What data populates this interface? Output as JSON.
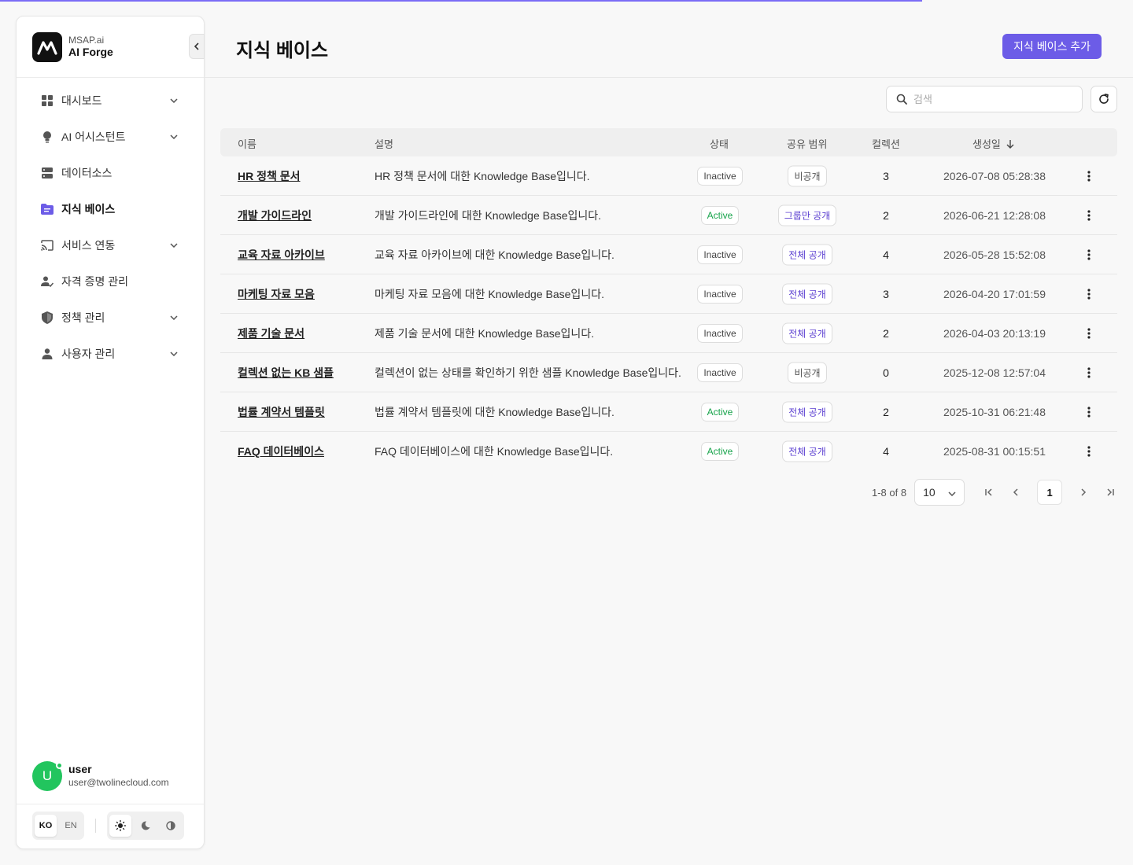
{
  "colors": {
    "accent": "#6c5ce7",
    "active": "#16a34a",
    "scope_text": "#5b3fd1",
    "avatar": "#22c55e"
  },
  "brand": {
    "sub": "MSAP.ai",
    "name": "AI Forge"
  },
  "sidebar": {
    "items": [
      {
        "label": "대시보드",
        "icon": "dashboard-icon",
        "expandable": true
      },
      {
        "label": "AI 어시스턴트",
        "icon": "lightbulb-icon",
        "expandable": true
      },
      {
        "label": "데이터소스",
        "icon": "server-icon",
        "expandable": false
      },
      {
        "label": "지식 베이스",
        "icon": "folder-icon",
        "expandable": false,
        "active": true
      },
      {
        "label": "서비스 연동",
        "icon": "cast-icon",
        "expandable": true
      },
      {
        "label": "자격 증명 관리",
        "icon": "user-check-icon",
        "expandable": false
      },
      {
        "label": "정책 관리",
        "icon": "shield-icon",
        "expandable": true
      },
      {
        "label": "사용자 관리",
        "icon": "person-icon",
        "expandable": true
      }
    ]
  },
  "user": {
    "initial": "U",
    "name": "user",
    "email": "user@twolinecloud.com"
  },
  "lang": {
    "ko": "KO",
    "en": "EN",
    "selected": "KO"
  },
  "theme": {
    "selected": "light"
  },
  "page": {
    "title": "지식 베이스",
    "add_button": "지식 베이스 추가"
  },
  "search": {
    "placeholder": "검색",
    "value": ""
  },
  "table": {
    "headers": {
      "name": "이름",
      "description": "설명",
      "status": "상태",
      "scope": "공유 범위",
      "collections": "컬렉션",
      "created": "생성일"
    },
    "sort": {
      "column": "created",
      "direction": "desc"
    },
    "rows": [
      {
        "name": "HR 정책 문서",
        "description": "HR 정책 문서에 대한 Knowledge Base입니다.",
        "status": "Inactive",
        "scope": "비공개",
        "collections": "3",
        "created": "2026-07-08 05:28:38"
      },
      {
        "name": "개발 가이드라인",
        "description": "개발 가이드라인에 대한 Knowledge Base입니다.",
        "status": "Active",
        "scope": "그룹만 공개",
        "collections": "2",
        "created": "2026-06-21 12:28:08"
      },
      {
        "name": "교육 자료 아카이브",
        "description": "교육 자료 아카이브에 대한 Knowledge Base입니다.",
        "status": "Inactive",
        "scope": "전체 공개",
        "collections": "4",
        "created": "2026-05-28 15:52:08"
      },
      {
        "name": "마케팅 자료 모음",
        "description": "마케팅 자료 모음에 대한 Knowledge Base입니다.",
        "status": "Inactive",
        "scope": "전체 공개",
        "collections": "3",
        "created": "2026-04-20 17:01:59"
      },
      {
        "name": "제품 기술 문서",
        "description": "제품 기술 문서에 대한 Knowledge Base입니다.",
        "status": "Inactive",
        "scope": "전체 공개",
        "collections": "2",
        "created": "2026-04-03 20:13:19"
      },
      {
        "name": "컬렉션 없는 KB 샘플",
        "description": "컬렉션이 없는 상태를 확인하기 위한 샘플 Knowledge Base입니다.",
        "status": "Inactive",
        "scope": "비공개",
        "collections": "0",
        "created": "2025-12-08 12:57:04"
      },
      {
        "name": "법률 계약서 템플릿",
        "description": "법률 계약서 템플릿에 대한 Knowledge Base입니다.",
        "status": "Active",
        "scope": "전체 공개",
        "collections": "2",
        "created": "2025-10-31 06:21:48"
      },
      {
        "name": "FAQ 데이터베이스",
        "description": "FAQ 데이터베이스에 대한 Knowledge Base입니다.",
        "status": "Active",
        "scope": "전체 공개",
        "collections": "4",
        "created": "2025-08-31 00:15:51"
      }
    ]
  },
  "pagination": {
    "range": "1-8 of 8",
    "page_size": "10",
    "current_page": "1"
  }
}
